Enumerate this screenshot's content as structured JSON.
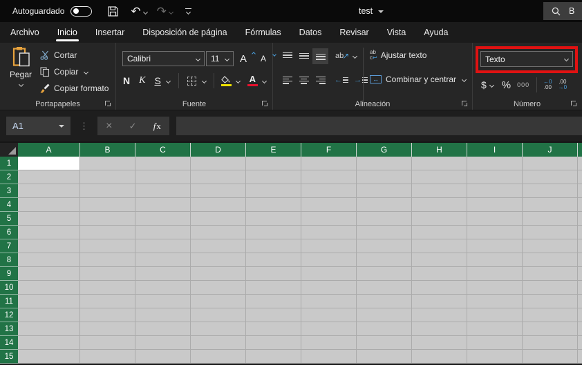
{
  "titlebar": {
    "autosave_label": "Autoguardado",
    "doc_title": "test",
    "search_text": "B"
  },
  "tabs": [
    {
      "label": "Archivo"
    },
    {
      "label": "Inicio"
    },
    {
      "label": "Insertar"
    },
    {
      "label": "Disposición de página"
    },
    {
      "label": "Fórmulas"
    },
    {
      "label": "Datos"
    },
    {
      "label": "Revisar"
    },
    {
      "label": "Vista"
    },
    {
      "label": "Ayuda"
    }
  ],
  "active_tab": "Inicio",
  "ribbon": {
    "clipboard": {
      "group_label": "Portapapeles",
      "paste": "Pegar",
      "cut": "Cortar",
      "copy": "Copiar",
      "format_painter": "Copiar formato"
    },
    "font": {
      "group_label": "Fuente",
      "family": "Calibri",
      "size": "11",
      "bold": "N",
      "italic": "K",
      "underline": "S"
    },
    "alignment": {
      "group_label": "Alineación",
      "orientation_text": "ab",
      "orientation_arrow": "↗",
      "wrap_icon_top": "ab",
      "wrap_icon_bottom": "c",
      "wrap_icon_arrow": "↩",
      "wrap_text": "Ajustar texto",
      "merge_icon_arrow": "↔",
      "merge_text": "Combinar y centrar"
    },
    "number": {
      "group_label": "Número",
      "format_value": "Texto",
      "currency": "$",
      "percent": "%",
      "thousands": "000",
      "inc_decimal_top": "←0",
      "inc_decimal_bottom": ".00",
      "dec_decimal_top": ".00",
      "dec_decimal_bottom": "→0"
    }
  },
  "formula_bar": {
    "cell_reference": "A1",
    "cancel_glyph": "×",
    "enter_glyph": "✓",
    "fx_label": "x"
  },
  "grid": {
    "columns": [
      "A",
      "B",
      "C",
      "D",
      "E",
      "F",
      "G",
      "H",
      "I",
      "J"
    ],
    "rows": [
      "1",
      "2",
      "3",
      "4",
      "5",
      "6",
      "7",
      "8",
      "9",
      "10",
      "11",
      "12",
      "13",
      "14",
      "15"
    ],
    "selected": "A1"
  },
  "colors": {
    "header_green": "#217346",
    "cell_gray": "#c9c9c9",
    "gridline": "#ababab",
    "annotation_red": "#e01212",
    "accent_blue": "#4a9edb",
    "fill_yellow": "#f0e200",
    "font_color_red": "#e8112d",
    "clipboard_orange": "#e8a33d"
  }
}
